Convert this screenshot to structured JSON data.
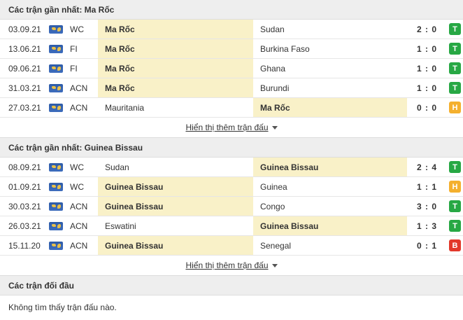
{
  "colors": {
    "win": "#27a844",
    "draw": "#f4b02e",
    "loss": "#e2382a",
    "highlight": "#f9f1c8"
  },
  "sections": [
    {
      "title": "Các trận gần nhất: Ma Rốc",
      "matches": [
        {
          "date": "03.09.21",
          "comp": "WC",
          "home": "Ma Rốc",
          "away": "Sudan",
          "score": "2 : 0",
          "result": "T",
          "hl": "home"
        },
        {
          "date": "13.06.21",
          "comp": "FI",
          "home": "Ma Rốc",
          "away": "Burkina Faso",
          "score": "1 : 0",
          "result": "T",
          "hl": "home"
        },
        {
          "date": "09.06.21",
          "comp": "FI",
          "home": "Ma Rốc",
          "away": "Ghana",
          "score": "1 : 0",
          "result": "T",
          "hl": "home"
        },
        {
          "date": "31.03.21",
          "comp": "ACN",
          "home": "Ma Rốc",
          "away": "Burundi",
          "score": "1 : 0",
          "result": "T",
          "hl": "home"
        },
        {
          "date": "27.03.21",
          "comp": "ACN",
          "home": "Mauritania",
          "away": "Ma Rốc",
          "score": "0 : 0",
          "result": "H",
          "hl": "away"
        }
      ],
      "more_label": "Hiển thị thêm trận đấu"
    },
    {
      "title": "Các trận gần nhất: Guinea Bissau",
      "matches": [
        {
          "date": "08.09.21",
          "comp": "WC",
          "home": "Sudan",
          "away": "Guinea Bissau",
          "score": "2 : 4",
          "result": "T",
          "hl": "away"
        },
        {
          "date": "01.09.21",
          "comp": "WC",
          "home": "Guinea Bissau",
          "away": "Guinea",
          "score": "1 : 1",
          "result": "H",
          "hl": "home"
        },
        {
          "date": "30.03.21",
          "comp": "ACN",
          "home": "Guinea Bissau",
          "away": "Congo",
          "score": "3 : 0",
          "result": "T",
          "hl": "home"
        },
        {
          "date": "26.03.21",
          "comp": "ACN",
          "home": "Eswatini",
          "away": "Guinea Bissau",
          "score": "1 : 3",
          "result": "T",
          "hl": "away"
        },
        {
          "date": "15.11.20",
          "comp": "ACN",
          "home": "Guinea Bissau",
          "away": "Senegal",
          "score": "0 : 1",
          "result": "B",
          "hl": "home"
        }
      ],
      "more_label": "Hiển thị thêm trận đấu"
    }
  ],
  "h2h": {
    "title": "Các trận đối đầu",
    "empty_text": "Không tìm thấy trận đấu nào."
  }
}
